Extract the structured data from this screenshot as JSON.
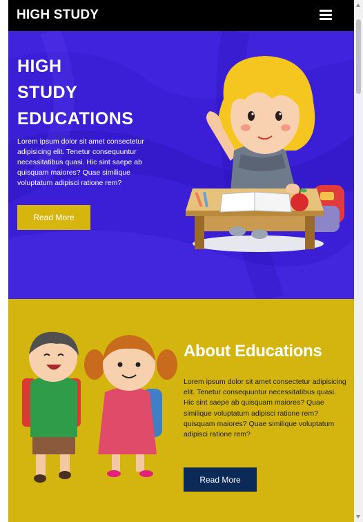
{
  "header": {
    "brand": "HIGH STUDY"
  },
  "hero": {
    "title_line1": "HIGH",
    "title_line2": "STUDY",
    "title_line3": "EDUCATIONS",
    "text": "Lorem ipsum dolor sit amet consectetur adipisicing elit. Tenetur consequuntur necessitatibus quasi. Hic sint saepe ab quisquam maiores? Quae similique voluptatum adipisci ratione rem?",
    "button_label": "Read More"
  },
  "about": {
    "title": "About Educations",
    "text": "Lorem ipsum dolor sit amet consectetur adipisicing elit. Tenetur consequuntur necessitatibus quasi. Hic sint saepe ab quisquam maiores? Quae similique voluptatum adipisci ratione rem? quisquam maiores? Quae similique voluptatum adipisci ratione rem?",
    "button_label": "Read More"
  },
  "icons": {
    "menu": "hamburger-menu-icon",
    "hero_image": "girl-at-desk-illustration",
    "about_image": "kids-with-backpacks-illustration"
  },
  "colors": {
    "header_bg": "#000000",
    "hero_bg": "#3a1fd6",
    "about_bg": "#d4b50f",
    "hero_button": "#d6b60e",
    "about_button": "#0b2a57"
  }
}
